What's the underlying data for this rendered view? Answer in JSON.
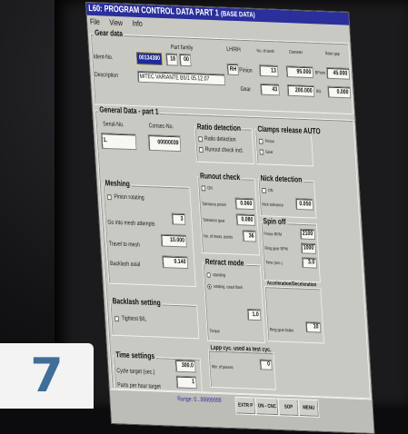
{
  "window": {
    "title": "L60: PROGRAM CONTROL DATA PART 1",
    "subtitle": "(BASE DATA)"
  },
  "menu": [
    "File",
    "View",
    "Info"
  ],
  "gear_data": {
    "title": "Gear data",
    "ident_label": "Ident-No.",
    "ident_value": "00134380",
    "part_family_label": "Part family",
    "part_family_1": "18",
    "part_family_2": "00",
    "lhrh_label": "LH/RH",
    "lhrh_value": "RH",
    "description_label": "Description",
    "description_value": "MITEC VARIANTE B5/1 05.12.07",
    "no_teeth_label": "No. of teeth",
    "diameter_label": "Diameter",
    "base_gap_label": "Base gap",
    "pinion_label": "Pinion",
    "pinion_teeth": "13",
    "pinion_diameter": "95.000",
    "pinion_unit": "BPoint",
    "pinion_gap": "45.000",
    "gear_label": "Gear",
    "gear_teeth": "43",
    "gear_diameter": "200.000",
    "gear_unit": "BG",
    "gear_gap": "0.000"
  },
  "general": {
    "title": "General Data - part 1",
    "serial_label": "Serial-No.",
    "serial_value": "1.",
    "consec_label": "Consec-No.",
    "consec_value": "00000039"
  },
  "ratio_detection": {
    "title": "Ratio detection",
    "opt1": "Ratio detection",
    "opt2": "Runout check incl."
  },
  "clamps": {
    "title": "Clamps release AUTO",
    "opt1": "Pinion",
    "opt2": "Gear"
  },
  "meshing": {
    "title": "Meshing",
    "pinion_rotating": "Pinion rotating",
    "attempts_label": "Go into mesh attempts",
    "attempts_value": "3",
    "travel_label": "Travel to mesh",
    "travel_value": "10.000",
    "backlash_label": "Backlash axial",
    "backlash_value": "0.140"
  },
  "runout": {
    "title": "Runout check",
    "on_label": "ON",
    "tol_pinion_label": "Tolerance pinion",
    "tol_pinion_value": "0.060",
    "tol_gear_label": "Tolerance gear",
    "tol_gear_value": "0.080",
    "points_label": "No. of meas. points",
    "points_value": "36"
  },
  "nick": {
    "title": "Nick detection",
    "on_label": "ON",
    "tol_label": "Nick tolerance",
    "tol_value": "0.050"
  },
  "spin_off": {
    "title": "Spin off",
    "pinion_label": "Pinion RPM",
    "pinion_value": "2100",
    "ring_label": "Ring gear RPM",
    "ring_value": "1000",
    "time_label": "Time (sec.)",
    "time_value": "3.0"
  },
  "retract": {
    "title": "Retract mode",
    "opt1": "standing",
    "opt2": "rotating, coast flank",
    "torque_label": "Torque",
    "torque_value": "1.0"
  },
  "accel": {
    "title": "Acceleration/Deceleration",
    "ring_brake_label": "Ring gear brake",
    "ring_brake_value": "10"
  },
  "backlash_setting": {
    "title": "Backlash setting",
    "tightest": "Tightest B/L"
  },
  "lapp": {
    "title": "Lapp cyc. used as test cyc.",
    "passes_label": "Nbr. of passes",
    "passes_value": "0"
  },
  "time_settings": {
    "title": "Time settings",
    "cycle_label": "Cycle target (sec.)",
    "cycle_value": "300.0",
    "parts_label": "Parts per hour target",
    "parts_value": "1"
  },
  "status": {
    "range_text": "Range: 0...99999999"
  },
  "softkeys": [
    "EXTR P",
    "ON - CNC",
    "SOP",
    "MENU"
  ],
  "badge": {
    "number": "7"
  },
  "colors": {
    "titlebar": "#2a2f9c",
    "screen_bg": "#c9c9c4",
    "badge_text": "#3f6e98"
  }
}
